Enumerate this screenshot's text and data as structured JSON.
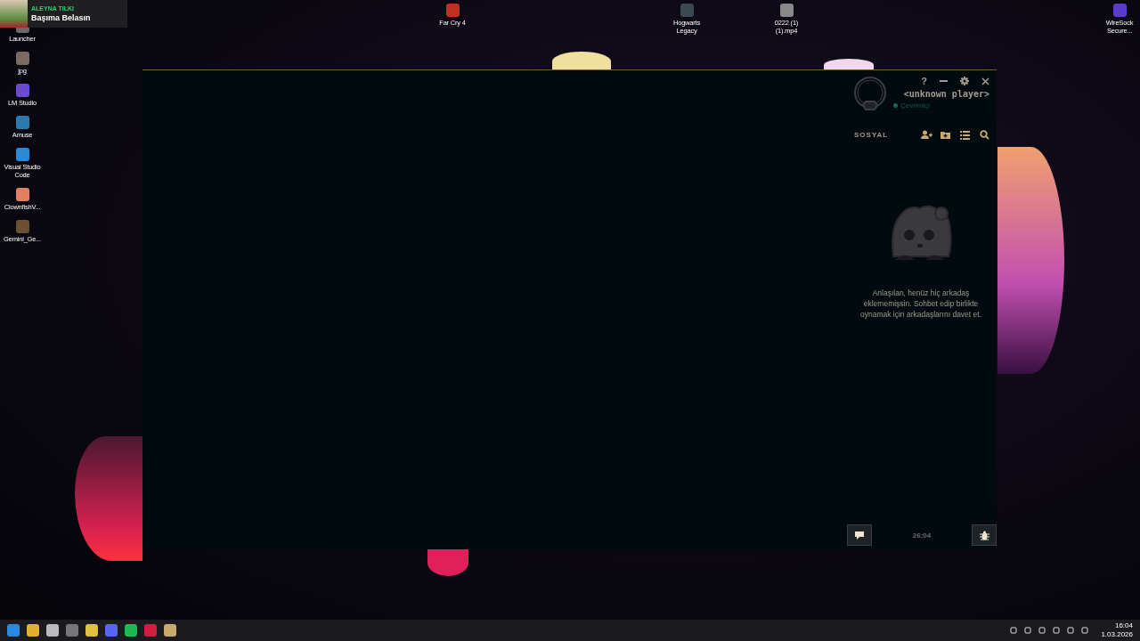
{
  "now_playing": {
    "artist": "ALEYNA TILKI",
    "title": "Başıma Belasın"
  },
  "desktop_icons_left": [
    {
      "label": "Launcher"
    },
    {
      "label": "jpg"
    },
    {
      "label": "LM Studio"
    },
    {
      "label": "Amuse"
    },
    {
      "label": "Visual Studio Code"
    },
    {
      "label": "ClownfishV..."
    },
    {
      "label": "Gemini_Ge..."
    }
  ],
  "desktop_icons_top": [
    {
      "label": "Far Cry 4"
    },
    {
      "label": "Hogwarts Legacy"
    },
    {
      "label": "0222 (1)(1).mp4"
    },
    {
      "label": "WireSock Secure..."
    }
  ],
  "client_window": {
    "title_buttons": [
      "?"
    ],
    "player": {
      "name": "<unknown player>",
      "status": "Çevrimiçi"
    },
    "social": {
      "title": "SOSYAL",
      "empty_message": "Anlaşılan, henüz hiç arkadaş eklememişsin. Sohbet edip birlikte oynamak için arkadaşlarını davet et."
    },
    "footer": {
      "time": "26:04"
    }
  },
  "taskbar": {
    "clock": {
      "time": "16:04",
      "date": "1.03.2026"
    }
  }
}
